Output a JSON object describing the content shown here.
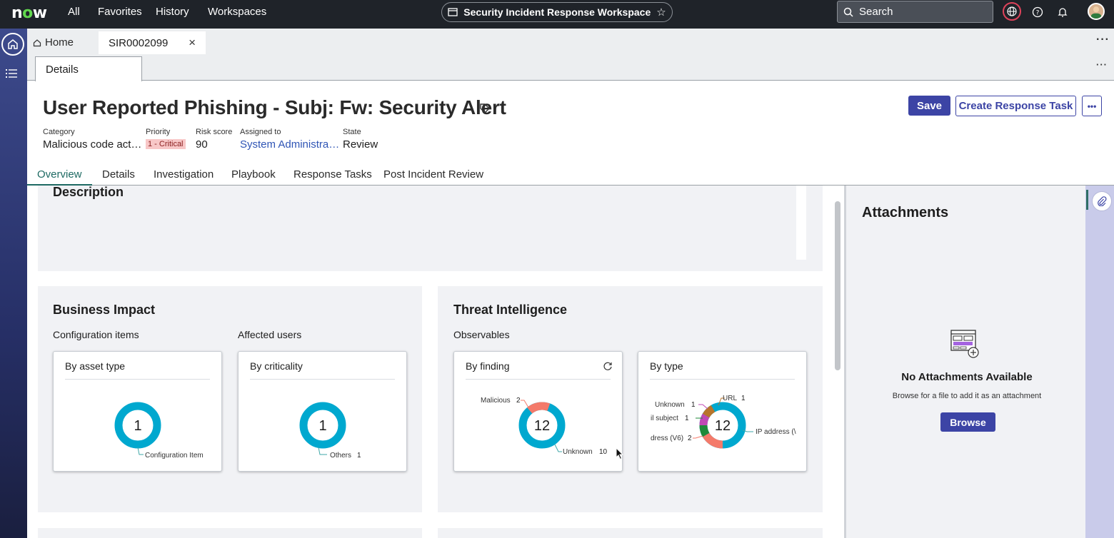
{
  "nav": {
    "logo": "now",
    "links": [
      "All",
      "Favorites",
      "History",
      "Workspaces"
    ],
    "workspace_title": "Security Incident Response Workspace",
    "search_placeholder": "Search"
  },
  "tabs": {
    "home_label": "Home",
    "record_tab_label": "SIR0002099",
    "sub_tab_label": "Details"
  },
  "record": {
    "title": "User Reported Phishing - Subj: Fw: Security Alert",
    "save_label": "Save",
    "create_task_label": "Create Response Task",
    "fields": {
      "category_label": "Category",
      "category_value": "Malicious code act…",
      "priority_label": "Priority",
      "priority_value": "1 - Critical",
      "risk_label": "Risk score",
      "risk_value": "90",
      "assigned_label": "Assigned to",
      "assigned_value": "System Administra…",
      "state_label": "State",
      "state_value": "Review"
    },
    "record_tabs": [
      "Overview",
      "Details",
      "Investigation",
      "Playbook",
      "Response Tasks",
      "Post Incident Review"
    ]
  },
  "overview": {
    "description_title": "Description",
    "business_impact": {
      "title": "Business Impact",
      "config_items_label": "Configuration items",
      "affected_users_label": "Affected users",
      "by_asset_type": {
        "title": "By asset type",
        "total": "1",
        "legend": "Configuration Item"
      },
      "by_criticality": {
        "title": "By criticality",
        "total": "1",
        "legend": "Others",
        "legend_count": "1"
      }
    },
    "threat_intel": {
      "title": "Threat Intelligence",
      "observables_label": "Observables",
      "by_finding": {
        "title": "By finding",
        "total": "12",
        "labels": [
          {
            "name": "Malicious",
            "count": "2"
          },
          {
            "name": "Unknown",
            "count": "10"
          }
        ]
      },
      "by_type": {
        "title": "By type",
        "total": "12",
        "labels": [
          {
            "name": "Unknown",
            "count": "1"
          },
          {
            "name": "URL",
            "count": "1"
          },
          {
            "name": "il subject",
            "count": "1"
          },
          {
            "name": "dress (V6)",
            "count": "2"
          },
          {
            "name": "IP address (\\",
            "count": ""
          }
        ]
      }
    }
  },
  "chart_data": [
    {
      "type": "pie",
      "title": "By asset type",
      "categories": [
        "Configuration Item"
      ],
      "values": [
        1
      ]
    },
    {
      "type": "pie",
      "title": "By criticality",
      "categories": [
        "Others"
      ],
      "values": [
        1
      ]
    },
    {
      "type": "pie",
      "title": "By finding",
      "categories": [
        "Malicious",
        "Unknown"
      ],
      "values": [
        2,
        10
      ]
    },
    {
      "type": "pie",
      "title": "By type",
      "categories": [
        "IP address (\\",
        "dress (V6)",
        "il subject",
        "Unknown",
        "URL"
      ],
      "values": [
        7,
        2,
        1,
        1,
        1
      ]
    }
  ],
  "attachments": {
    "title": "Attachments",
    "empty_title": "No Attachments Available",
    "empty_desc": "Browse for a file to add it as an attachment",
    "browse_label": "Browse"
  },
  "colors": {
    "primary": "#3c44a5",
    "accent_teal": "#1e6a63",
    "donut_cyan": "#00a8cf",
    "donut_salmon": "#f47a6a",
    "donut_green": "#1f8a3a",
    "donut_magenta": "#c048b5",
    "donut_brown": "#b8752b"
  }
}
